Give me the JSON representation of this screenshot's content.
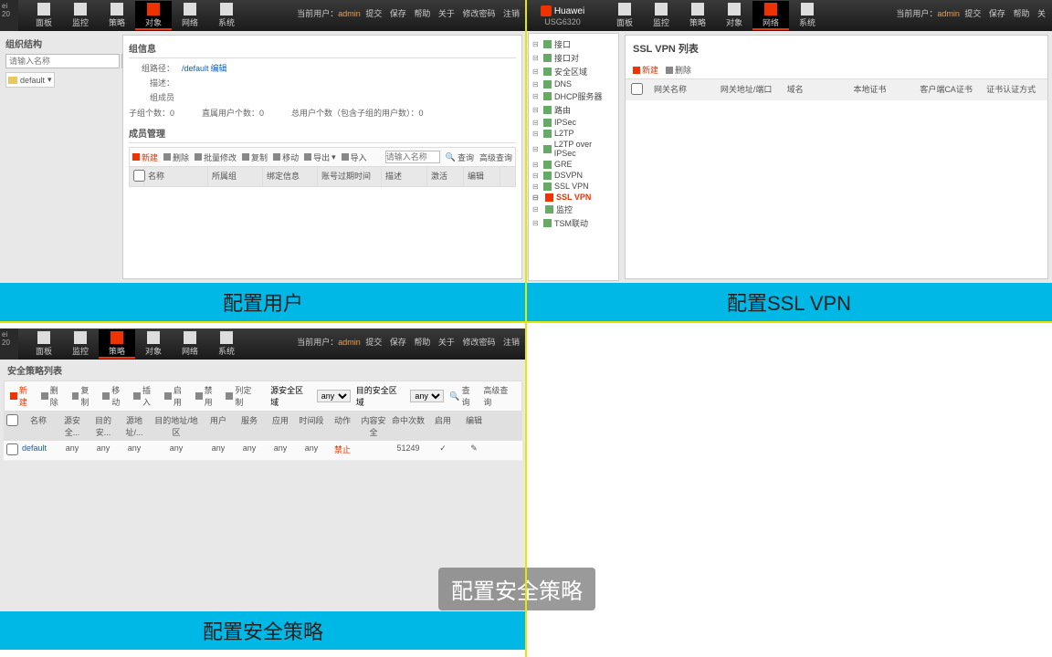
{
  "labels": {
    "q1": "配置用户",
    "q2": "配置SSL VPN",
    "q3": "配置安全策略",
    "overlay": "配置安全策略"
  },
  "topbar": {
    "brand_name": "Huawei",
    "brand_model": "USG6320",
    "brand_slice": "ei\n20",
    "user_prefix": "当前用户：",
    "user": "admin",
    "actions": [
      "提交",
      "保存",
      "帮助",
      "关于",
      "修改密码",
      "注销"
    ],
    "actions_short": [
      "提交",
      "保存",
      "帮助",
      "关"
    ],
    "nav": [
      "面板",
      "监控",
      "策略",
      "对象",
      "网络",
      "系统"
    ]
  },
  "q1": {
    "side_title": "组织结构",
    "search_ph": "请输入名称",
    "search_btn": "查询",
    "root_node": "default",
    "info_title": "组信息",
    "path_label": "组路径：",
    "path_value": "/default",
    "path_edit": "编辑",
    "desc_label": "描述：",
    "members_label": "组成员",
    "count1": "子组个数：0",
    "count2": "直属用户个数：0",
    "count3": "总用户个数（包含子组的用户数）：0",
    "member_mgmt": "成员管理",
    "tools": {
      "new": "新建",
      "del": "删除",
      "batch": "批量修改",
      "copy": "复制",
      "move": "移动",
      "export": "导出",
      "import": "导入"
    },
    "grid_search_ph": "请输入名称",
    "grid_search": "查询",
    "adv_search": "高级查询",
    "cols": [
      "名称",
      "所属组",
      "绑定信息",
      "账号过期时间",
      "描述",
      "激活",
      "编辑"
    ]
  },
  "q2": {
    "tree": [
      {
        "label": "接口"
      },
      {
        "label": "接口对"
      },
      {
        "label": "安全区域"
      },
      {
        "label": "DNS"
      },
      {
        "label": "DHCP服务器"
      },
      {
        "label": "路由"
      },
      {
        "label": "IPSec"
      },
      {
        "label": "L2TP"
      },
      {
        "label": "L2TP over IPSec"
      },
      {
        "label": "GRE"
      },
      {
        "label": "DSVPN"
      },
      {
        "label": "SSL VPN",
        "children": [
          {
            "label": "SSL VPN",
            "sel": true
          },
          {
            "label": "监控"
          }
        ]
      },
      {
        "label": "TSM联动"
      }
    ],
    "list_title": "SSL VPN 列表",
    "tools": {
      "new": "新建",
      "del": "删除"
    },
    "cols": [
      "网关名称",
      "网关地址/端口",
      "域名",
      "本地证书",
      "客户端CA证书",
      "证书认证方式"
    ]
  },
  "q3": {
    "title": "安全策略列表",
    "tools": {
      "new": "新建",
      "del": "删除",
      "copy": "复制",
      "move": "移动",
      "insert": "插入",
      "enable": "启用",
      "disable": "禁用",
      "cols": "列定制"
    },
    "filter": {
      "src_label": "源安全区域",
      "dst_label": "目的安全区域",
      "any": "any",
      "search": "查询",
      "adv": "高级查询"
    },
    "cols": [
      "",
      "名称",
      "源安全...",
      "目的安...",
      "源地址/...",
      "目的地址/地区",
      "用户",
      "服务",
      "应用",
      "时间段",
      "动作",
      "内容安全",
      "命中次数",
      "启用",
      "编辑"
    ],
    "row": {
      "name": "default",
      "any": "any",
      "action": "禁止",
      "hits": "51249",
      "enable": "✓",
      "edit": "✎"
    }
  }
}
